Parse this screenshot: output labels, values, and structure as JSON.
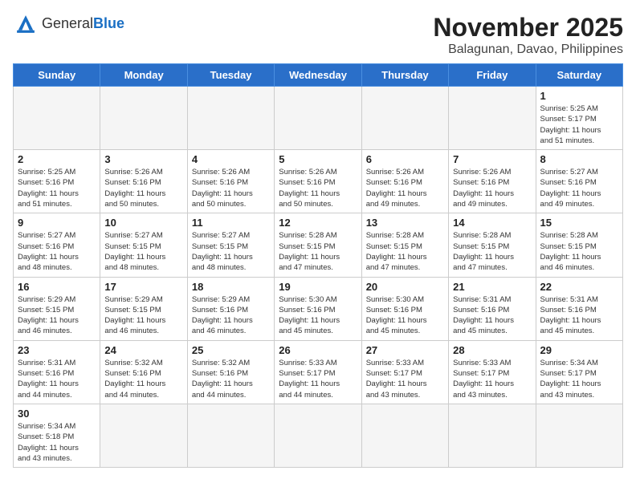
{
  "header": {
    "logo_general": "General",
    "logo_blue": "Blue",
    "month_title": "November 2025",
    "location": "Balagunan, Davao, Philippines"
  },
  "days_of_week": [
    "Sunday",
    "Monday",
    "Tuesday",
    "Wednesday",
    "Thursday",
    "Friday",
    "Saturday"
  ],
  "weeks": [
    [
      {
        "day": "",
        "info": ""
      },
      {
        "day": "",
        "info": ""
      },
      {
        "day": "",
        "info": ""
      },
      {
        "day": "",
        "info": ""
      },
      {
        "day": "",
        "info": ""
      },
      {
        "day": "",
        "info": ""
      },
      {
        "day": "1",
        "info": "Sunrise: 5:25 AM\nSunset: 5:17 PM\nDaylight: 11 hours\nand 51 minutes."
      }
    ],
    [
      {
        "day": "2",
        "info": "Sunrise: 5:25 AM\nSunset: 5:16 PM\nDaylight: 11 hours\nand 51 minutes."
      },
      {
        "day": "3",
        "info": "Sunrise: 5:26 AM\nSunset: 5:16 PM\nDaylight: 11 hours\nand 50 minutes."
      },
      {
        "day": "4",
        "info": "Sunrise: 5:26 AM\nSunset: 5:16 PM\nDaylight: 11 hours\nand 50 minutes."
      },
      {
        "day": "5",
        "info": "Sunrise: 5:26 AM\nSunset: 5:16 PM\nDaylight: 11 hours\nand 50 minutes."
      },
      {
        "day": "6",
        "info": "Sunrise: 5:26 AM\nSunset: 5:16 PM\nDaylight: 11 hours\nand 49 minutes."
      },
      {
        "day": "7",
        "info": "Sunrise: 5:26 AM\nSunset: 5:16 PM\nDaylight: 11 hours\nand 49 minutes."
      },
      {
        "day": "8",
        "info": "Sunrise: 5:27 AM\nSunset: 5:16 PM\nDaylight: 11 hours\nand 49 minutes."
      }
    ],
    [
      {
        "day": "9",
        "info": "Sunrise: 5:27 AM\nSunset: 5:16 PM\nDaylight: 11 hours\nand 48 minutes."
      },
      {
        "day": "10",
        "info": "Sunrise: 5:27 AM\nSunset: 5:15 PM\nDaylight: 11 hours\nand 48 minutes."
      },
      {
        "day": "11",
        "info": "Sunrise: 5:27 AM\nSunset: 5:15 PM\nDaylight: 11 hours\nand 48 minutes."
      },
      {
        "day": "12",
        "info": "Sunrise: 5:28 AM\nSunset: 5:15 PM\nDaylight: 11 hours\nand 47 minutes."
      },
      {
        "day": "13",
        "info": "Sunrise: 5:28 AM\nSunset: 5:15 PM\nDaylight: 11 hours\nand 47 minutes."
      },
      {
        "day": "14",
        "info": "Sunrise: 5:28 AM\nSunset: 5:15 PM\nDaylight: 11 hours\nand 47 minutes."
      },
      {
        "day": "15",
        "info": "Sunrise: 5:28 AM\nSunset: 5:15 PM\nDaylight: 11 hours\nand 46 minutes."
      }
    ],
    [
      {
        "day": "16",
        "info": "Sunrise: 5:29 AM\nSunset: 5:15 PM\nDaylight: 11 hours\nand 46 minutes."
      },
      {
        "day": "17",
        "info": "Sunrise: 5:29 AM\nSunset: 5:15 PM\nDaylight: 11 hours\nand 46 minutes."
      },
      {
        "day": "18",
        "info": "Sunrise: 5:29 AM\nSunset: 5:16 PM\nDaylight: 11 hours\nand 46 minutes."
      },
      {
        "day": "19",
        "info": "Sunrise: 5:30 AM\nSunset: 5:16 PM\nDaylight: 11 hours\nand 45 minutes."
      },
      {
        "day": "20",
        "info": "Sunrise: 5:30 AM\nSunset: 5:16 PM\nDaylight: 11 hours\nand 45 minutes."
      },
      {
        "day": "21",
        "info": "Sunrise: 5:31 AM\nSunset: 5:16 PM\nDaylight: 11 hours\nand 45 minutes."
      },
      {
        "day": "22",
        "info": "Sunrise: 5:31 AM\nSunset: 5:16 PM\nDaylight: 11 hours\nand 45 minutes."
      }
    ],
    [
      {
        "day": "23",
        "info": "Sunrise: 5:31 AM\nSunset: 5:16 PM\nDaylight: 11 hours\nand 44 minutes."
      },
      {
        "day": "24",
        "info": "Sunrise: 5:32 AM\nSunset: 5:16 PM\nDaylight: 11 hours\nand 44 minutes."
      },
      {
        "day": "25",
        "info": "Sunrise: 5:32 AM\nSunset: 5:16 PM\nDaylight: 11 hours\nand 44 minutes."
      },
      {
        "day": "26",
        "info": "Sunrise: 5:33 AM\nSunset: 5:17 PM\nDaylight: 11 hours\nand 44 minutes."
      },
      {
        "day": "27",
        "info": "Sunrise: 5:33 AM\nSunset: 5:17 PM\nDaylight: 11 hours\nand 43 minutes."
      },
      {
        "day": "28",
        "info": "Sunrise: 5:33 AM\nSunset: 5:17 PM\nDaylight: 11 hours\nand 43 minutes."
      },
      {
        "day": "29",
        "info": "Sunrise: 5:34 AM\nSunset: 5:17 PM\nDaylight: 11 hours\nand 43 minutes."
      }
    ],
    [
      {
        "day": "30",
        "info": "Sunrise: 5:34 AM\nSunset: 5:18 PM\nDaylight: 11 hours\nand 43 minutes."
      },
      {
        "day": "",
        "info": ""
      },
      {
        "day": "",
        "info": ""
      },
      {
        "day": "",
        "info": ""
      },
      {
        "day": "",
        "info": ""
      },
      {
        "day": "",
        "info": ""
      },
      {
        "day": "",
        "info": ""
      }
    ]
  ]
}
